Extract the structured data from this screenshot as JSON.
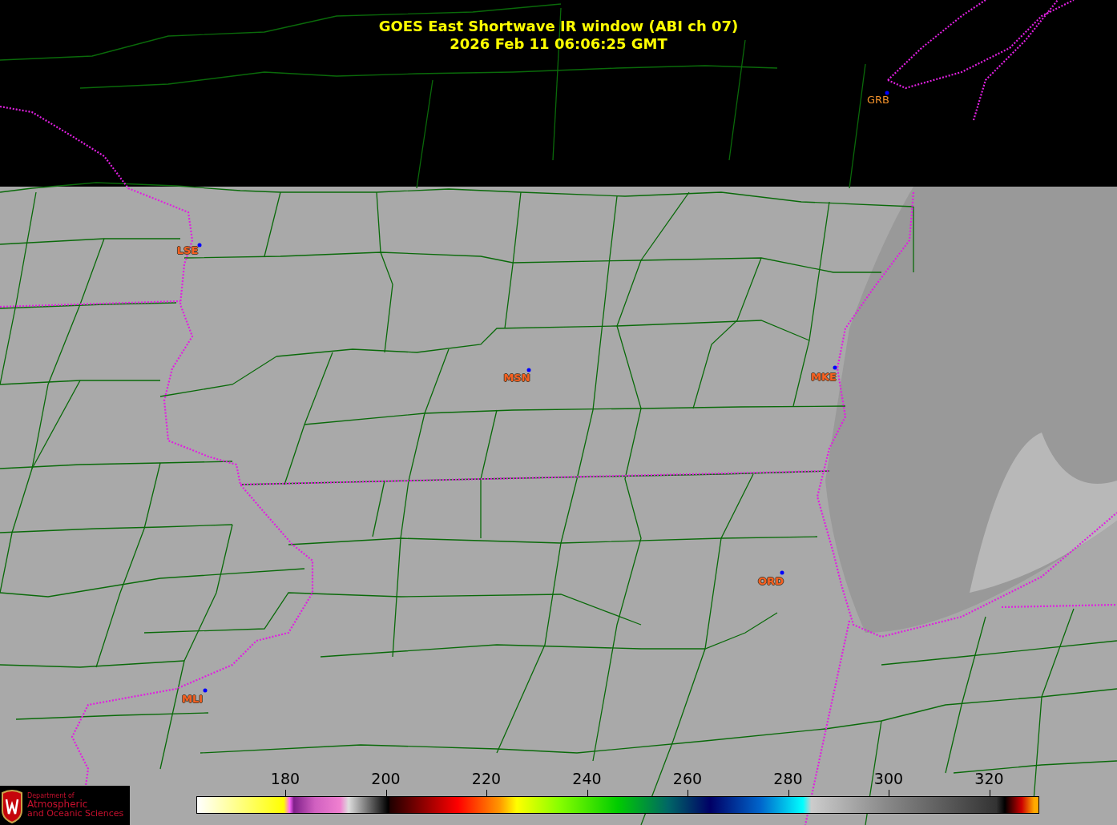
{
  "title": {
    "line_1": "GOES East Shortwave IR window (ABI ch 07)",
    "line_2": "2026 Feb 11  06:06:25 GMT"
  },
  "stations": [
    {
      "label": "GRB",
      "kind": "plain"
    },
    {
      "label": "LSE",
      "kind": "outlined"
    },
    {
      "label": "MSN",
      "kind": "outlined"
    },
    {
      "label": "MKE",
      "kind": "outlined"
    },
    {
      "label": "ORD",
      "kind": "outlined"
    },
    {
      "label": "MLI",
      "kind": "outlined"
    }
  ],
  "colorbar": {
    "ticks": [
      "180",
      "200",
      "220",
      "240",
      "260",
      "280",
      "300",
      "320"
    ]
  },
  "logo": {
    "line_1": "Department of",
    "line_2": "Atmospheric",
    "line_3": "and Oceanic Sciences"
  }
}
